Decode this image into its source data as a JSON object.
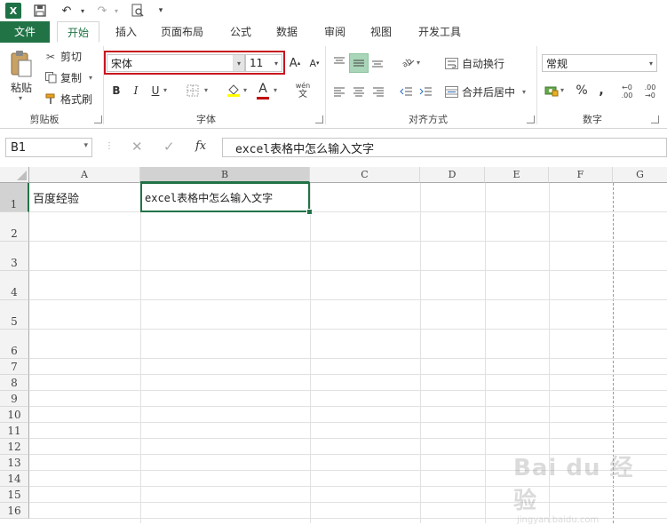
{
  "titlebar": {
    "logo_text": "X",
    "undo_icon": "↶",
    "redo_icon": "↷",
    "preview_icon": "🔍︎"
  },
  "tabs": [
    "文件",
    "开始",
    "插入",
    "页面布局",
    "公式",
    "数据",
    "审阅",
    "视图",
    "开发工具"
  ],
  "ribbon": {
    "clipboard": {
      "paste": "粘贴",
      "cut": "剪切",
      "copy": "复制",
      "format_painter": "格式刷",
      "label": "剪贴板"
    },
    "font": {
      "name": "宋体",
      "size": "11",
      "grow": "A",
      "shrink": "A",
      "bold": "B",
      "italic": "I",
      "underline": "U",
      "font_color": "A",
      "phonetic": "wén",
      "phonetic2": "文",
      "label": "字体",
      "highlight_color": "#c00000",
      "font_color_bar": "#c00000",
      "fill_color_bar": "#ffff00"
    },
    "alignment": {
      "wrap": "自动换行",
      "merge": "合并后居中",
      "label": "对齐方式"
    },
    "number": {
      "format": "常规",
      "percent": "%",
      "comma": ",",
      "inc_dec": "←0 .00",
      "dec_dec": ".00 →0",
      "label": "数字"
    }
  },
  "formula_bar": {
    "name_box": "B1",
    "fx": "fx",
    "content": "excel表格中怎么输入文字"
  },
  "grid": {
    "columns": [
      "A",
      "B",
      "C",
      "D",
      "E",
      "F",
      "G"
    ],
    "rows": [
      "1",
      "2",
      "3",
      "4",
      "5",
      "6",
      "7",
      "8",
      "9",
      "10",
      "11",
      "12",
      "13",
      "14",
      "15",
      "16"
    ],
    "cells": {
      "A1": "百度经验",
      "B1": "excel表格中怎么输入文字"
    },
    "selected": "B1",
    "accent": "#217346"
  },
  "watermark": {
    "text": "Bai du 经验",
    "sub": "jingyan.baidu.com"
  }
}
